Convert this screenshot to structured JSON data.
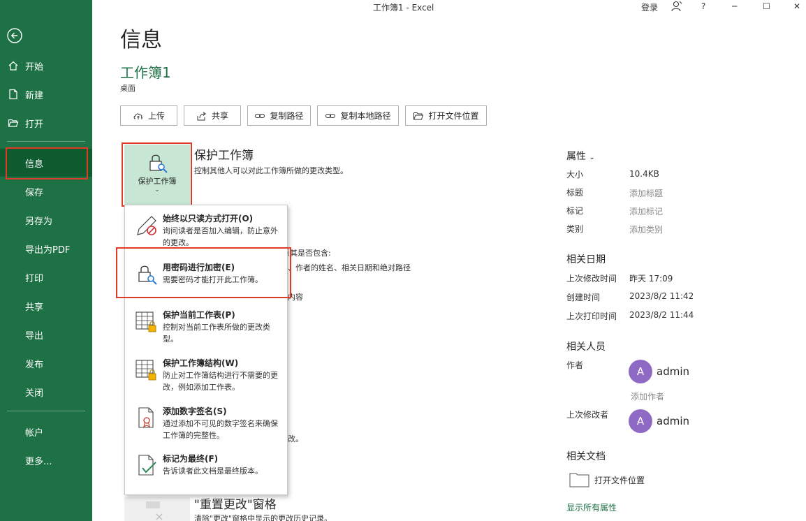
{
  "window": {
    "title": "工作簿1  -  Excel",
    "signin": "登录",
    "help": "?",
    "minimize": "─",
    "maximize": "☐",
    "close": "✕"
  },
  "nav": {
    "items": [
      {
        "label": "开始",
        "icon": "home-icon"
      },
      {
        "label": "新建",
        "icon": "new-doc-icon"
      },
      {
        "label": "打开",
        "icon": "folder-open-icon"
      },
      {
        "label": "信息",
        "active": true
      },
      {
        "label": "保存"
      },
      {
        "label": "另存为"
      },
      {
        "label": "导出为PDF"
      },
      {
        "label": "打印"
      },
      {
        "label": "共享"
      },
      {
        "label": "导出"
      },
      {
        "label": "发布"
      },
      {
        "label": "关闭"
      },
      {
        "label": "帐户"
      },
      {
        "label": "更多..."
      }
    ],
    "accent_color": "#1e7145",
    "highlight_color": "#e03b24"
  },
  "main": {
    "heading": "信息",
    "doc_name": "工作簿1",
    "doc_location": "桌面",
    "buttons": {
      "upload": "上传",
      "share": "共享",
      "copy_path": "复制路径",
      "copy_local_path": "复制本地路径",
      "open_location": "打开文件位置"
    },
    "protect": {
      "tile_label": "保护工作簿",
      "title": "保护工作簿",
      "desc": "控制其他人可以对此工作簿所做的更改类型。"
    },
    "inspect_partial": {
      "line1": "意其是否包含:",
      "line2": "、作者的姓名、相关日期和绝对路径",
      "line3": "内容"
    },
    "versions_partial": "改。",
    "reset": {
      "title": "\"重置更改\"窗格",
      "desc": "清除\"更改\"窗格中显示的更改历史记录。"
    }
  },
  "menu": {
    "items": [
      {
        "title": "始终以只读方式打开(O)",
        "desc": "询问读者是否加入编辑，防止意外的更改。",
        "icon": "pencil-no-icon"
      },
      {
        "title": "用密码进行加密(E)",
        "desc": "需要密码才能打开此工作簿。",
        "icon": "lock-key-icon"
      },
      {
        "title": "保护当前工作表(P)",
        "desc": "控制对当前工作表所做的更改类型。",
        "icon": "sheet-lock-icon"
      },
      {
        "title": "保护工作簿结构(W)",
        "desc": "防止对工作簿结构进行不需要的更改，例如添加工作表。",
        "icon": "workbook-lock-icon"
      },
      {
        "title": "添加数字签名(S)",
        "desc": "通过添加不可见的数字签名来确保工作簿的完整性。",
        "icon": "signature-icon"
      },
      {
        "title": "标记为最终(F)",
        "desc": "告诉读者此文档是最终版本。",
        "icon": "final-check-icon"
      }
    ]
  },
  "properties": {
    "heading": "属性",
    "rows": [
      {
        "key": "大小",
        "value": "10.4KB"
      },
      {
        "key": "标题",
        "value": "添加标题"
      },
      {
        "key": "标记",
        "value": "添加标记"
      },
      {
        "key": "类别",
        "value": "添加类别"
      }
    ],
    "dates_heading": "相关日期",
    "dates": [
      {
        "key": "上次修改时间",
        "value": "昨天 17:09"
      },
      {
        "key": "创建时间",
        "value": "2023/8/2 11:42"
      },
      {
        "key": "上次打印时间",
        "value": "2023/8/2 11:44"
      }
    ],
    "people_heading": "相关人员",
    "author_label": "作者",
    "author_initial": "A",
    "author_name": "admin",
    "add_author": "添加作者",
    "last_modifier_label": "上次修改者",
    "modifier_initial": "A",
    "modifier_name": "admin",
    "docs_heading": "相关文档",
    "open_location": "打开文件位置",
    "show_all": "显示所有属性"
  }
}
